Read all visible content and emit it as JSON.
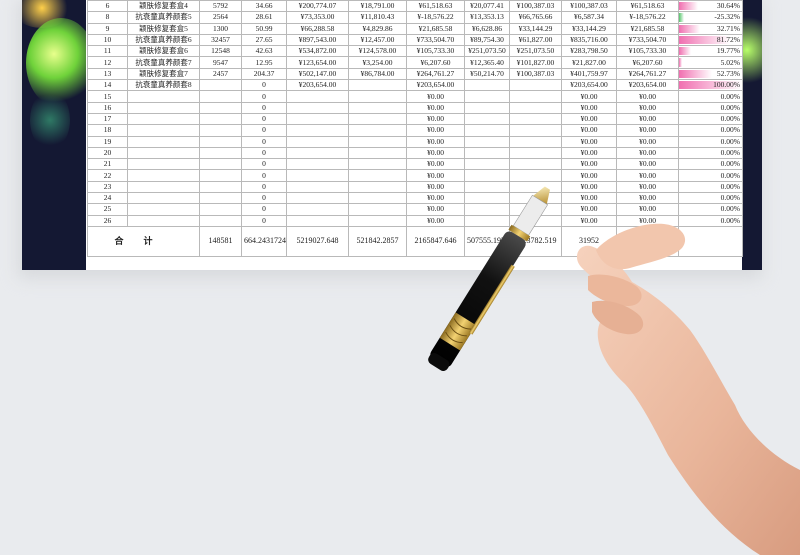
{
  "rows": [
    {
      "no": "6",
      "name": "颖肤修复套盒4",
      "qty": "5792",
      "price": "34.66",
      "sales": "¥200,774.07",
      "cost": "¥18,791.00",
      "profit": "¥61,518.63",
      "c8": "¥20,077.41",
      "c9": "¥100,387.03",
      "c10": "¥100,387.03",
      "c11": "¥61,518.63",
      "pct": "30.64%",
      "bar": 0.3064,
      "barColor": "#f06fb0"
    },
    {
      "no": "8",
      "name": "抗衰童真养颜套5",
      "qty": "2564",
      "price": "28.61",
      "sales": "¥73,353.00",
      "cost": "¥11,810.43",
      "profit": "¥-18,576.22",
      "c8": "¥13,353.13",
      "c9": "¥66,765.66",
      "c10": "¥6,587.34",
      "c11": "¥-18,576.22",
      "pct": "-25.32%",
      "bar": 0.08,
      "barColor": "#54c46a"
    },
    {
      "no": "9",
      "name": "颖肤修复套盒5",
      "qty": "1300",
      "price": "50.99",
      "sales": "¥66,288.58",
      "cost": "¥4,829.86",
      "profit": "¥21,685.58",
      "c8": "¥6,628.86",
      "c9": "¥33,144.29",
      "c10": "¥33,144.29",
      "c11": "¥21,685.58",
      "pct": "32.71%",
      "bar": 0.3271,
      "barColor": "#f06fb0"
    },
    {
      "no": "10",
      "name": "抗衰童真养颜套6",
      "qty": "32457",
      "price": "27.65",
      "sales": "¥897,543.00",
      "cost": "¥12,457.00",
      "profit": "¥733,504.70",
      "c8": "¥89,754.30",
      "c9": "¥61,827.00",
      "c10": "¥835,716.00",
      "c11": "¥733,504.70",
      "pct": "81.72%",
      "bar": 0.8172,
      "barColor": "#f06fb0"
    },
    {
      "no": "11",
      "name": "颖肤修复套盒6",
      "qty": "12548",
      "price": "42.63",
      "sales": "¥534,872.00",
      "cost": "¥124,578.00",
      "profit": "¥105,733.30",
      "c8": "¥251,073.50",
      "c9": "¥251,073.50",
      "c10": "¥283,798.50",
      "c11": "¥105,733.30",
      "pct": "19.77%",
      "bar": 0.1977,
      "barColor": "#f06fb0"
    },
    {
      "no": "12",
      "name": "抗衰童真养颜套7",
      "qty": "9547",
      "price": "12.95",
      "sales": "¥123,654.00",
      "cost": "¥3,254.00",
      "profit": "¥6,207.60",
      "c8": "¥12,365.40",
      "c9": "¥101,827.00",
      "c10": "¥21,827.00",
      "c11": "¥6,207.60",
      "pct": "5.02%",
      "bar": 0.0502,
      "barColor": "#f06fb0"
    },
    {
      "no": "13",
      "name": "颖肤修复套盒7",
      "qty": "2457",
      "price": "204.37",
      "sales": "¥502,147.00",
      "cost": "¥86,784.00",
      "profit": "¥264,761.27",
      "c8": "¥50,214.70",
      "c9": "¥100,387.03",
      "c10": "¥401,759.97",
      "c11": "¥264,761.27",
      "pct": "52.73%",
      "bar": 0.5273,
      "barColor": "#f06fb0"
    },
    {
      "no": "14",
      "name": "抗衰童真养颜套8",
      "qty": "",
      "price": "0",
      "sales": "¥203,654.00",
      "cost": "",
      "profit": "¥203,654.00",
      "c8": "",
      "c9": "",
      "c10": "¥203,654.00",
      "c11": "¥203,654.00",
      "pct": "100.00%",
      "bar": 1.0,
      "barColor": "#f06fb0"
    },
    {
      "no": "15",
      "name": "",
      "qty": "",
      "price": "0",
      "sales": "",
      "cost": "",
      "profit": "¥0.00",
      "c8": "",
      "c9": "",
      "c10": "¥0.00",
      "c11": "¥0.00",
      "pct": "0.00%",
      "bar": 0,
      "barColor": "#f06fb0"
    },
    {
      "no": "16",
      "name": "",
      "qty": "",
      "price": "0",
      "sales": "",
      "cost": "",
      "profit": "¥0.00",
      "c8": "",
      "c9": "",
      "c10": "¥0.00",
      "c11": "¥0.00",
      "pct": "0.00%",
      "bar": 0,
      "barColor": "#f06fb0"
    },
    {
      "no": "17",
      "name": "",
      "qty": "",
      "price": "0",
      "sales": "",
      "cost": "",
      "profit": "¥0.00",
      "c8": "",
      "c9": "",
      "c10": "¥0.00",
      "c11": "¥0.00",
      "pct": "0.00%",
      "bar": 0,
      "barColor": "#f06fb0"
    },
    {
      "no": "18",
      "name": "",
      "qty": "",
      "price": "0",
      "sales": "",
      "cost": "",
      "profit": "¥0.00",
      "c8": "",
      "c9": "",
      "c10": "¥0.00",
      "c11": "¥0.00",
      "pct": "0.00%",
      "bar": 0,
      "barColor": "#f06fb0"
    },
    {
      "no": "19",
      "name": "",
      "qty": "",
      "price": "0",
      "sales": "",
      "cost": "",
      "profit": "¥0.00",
      "c8": "",
      "c9": "",
      "c10": "¥0.00",
      "c11": "¥0.00",
      "pct": "0.00%",
      "bar": 0,
      "barColor": "#f06fb0"
    },
    {
      "no": "20",
      "name": "",
      "qty": "",
      "price": "0",
      "sales": "",
      "cost": "",
      "profit": "¥0.00",
      "c8": "",
      "c9": "",
      "c10": "¥0.00",
      "c11": "¥0.00",
      "pct": "0.00%",
      "bar": 0,
      "barColor": "#f06fb0"
    },
    {
      "no": "21",
      "name": "",
      "qty": "",
      "price": "0",
      "sales": "",
      "cost": "",
      "profit": "¥0.00",
      "c8": "",
      "c9": "",
      "c10": "¥0.00",
      "c11": "¥0.00",
      "pct": "0.00%",
      "bar": 0,
      "barColor": "#f06fb0"
    },
    {
      "no": "22",
      "name": "",
      "qty": "",
      "price": "0",
      "sales": "",
      "cost": "",
      "profit": "¥0.00",
      "c8": "",
      "c9": "",
      "c10": "¥0.00",
      "c11": "¥0.00",
      "pct": "0.00%",
      "bar": 0,
      "barColor": "#f06fb0"
    },
    {
      "no": "23",
      "name": "",
      "qty": "",
      "price": "0",
      "sales": "",
      "cost": "",
      "profit": "¥0.00",
      "c8": "",
      "c9": "",
      "c10": "¥0.00",
      "c11": "¥0.00",
      "pct": "0.00%",
      "bar": 0,
      "barColor": "#f06fb0"
    },
    {
      "no": "24",
      "name": "",
      "qty": "",
      "price": "0",
      "sales": "",
      "cost": "",
      "profit": "¥0.00",
      "c8": "",
      "c9": "",
      "c10": "¥0.00",
      "c11": "¥0.00",
      "pct": "0.00%",
      "bar": 0,
      "barColor": "#f06fb0"
    },
    {
      "no": "25",
      "name": "",
      "qty": "",
      "price": "0",
      "sales": "",
      "cost": "",
      "profit": "¥0.00",
      "c8": "",
      "c9": "",
      "c10": "¥0.00",
      "c11": "¥0.00",
      "pct": "0.00%",
      "bar": 0,
      "barColor": "#f06fb0"
    },
    {
      "no": "26",
      "name": "",
      "qty": "",
      "price": "0",
      "sales": "",
      "cost": "",
      "profit": "¥0.00",
      "c8": "",
      "c9": "",
      "c10": "¥0.00",
      "c11": "¥0.00",
      "pct": "0.00%",
      "bar": 0,
      "barColor": "#f06fb0"
    }
  ],
  "total": {
    "label": "合计",
    "qty": "148581",
    "price": "664.2431724",
    "sales": "5219027.648",
    "cost": "521842.2857",
    "profit": "2165847.646",
    "c8": "507555.1971",
    "c9": "2023782.519",
    "c10": "31952"
  },
  "colors": {
    "bar_positive": "#f06fb0",
    "bar_negative": "#54c46a",
    "dark_panel": "#141833"
  }
}
